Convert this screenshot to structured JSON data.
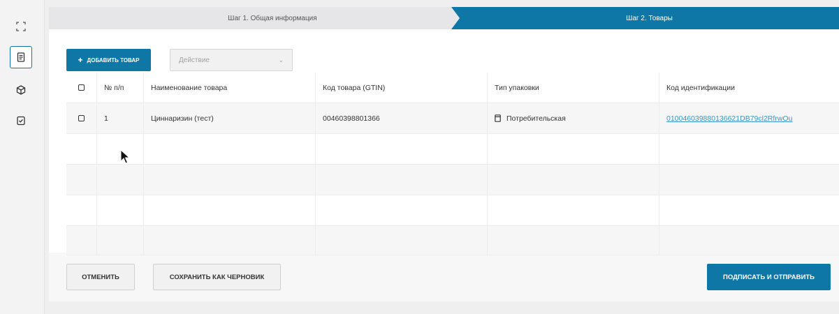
{
  "sidebar": {
    "items": [
      {
        "icon": "expand-icon",
        "active": false
      },
      {
        "icon": "document-icon",
        "active": true
      },
      {
        "icon": "box-icon",
        "active": false
      },
      {
        "icon": "checklist-icon",
        "active": false
      }
    ]
  },
  "stepper": {
    "step1": "Шаг 1. Общая информация",
    "step2": "Шаг 2. Товары"
  },
  "toolbar": {
    "add_label": "ДОБАВИТЬ ТОВАР",
    "add_icon": "+",
    "action_placeholder": "Действие"
  },
  "table": {
    "headers": [
      "№ п/п",
      "Наименование товара",
      "Код товара (GTIN)",
      "Тип упаковки",
      "Код идентификации"
    ],
    "rows": [
      {
        "num": "1",
        "name": "Циннаризин (тест)",
        "gtin": "00460398801366",
        "package": "Потребительская",
        "code": "010046039880136621DB79cl2RfrwOu"
      }
    ]
  },
  "footer": {
    "cancel_label": "ОТМЕНИТЬ",
    "draft_label": "СОХРАНИТЬ КАК ЧЕРНОВИК",
    "sign_label": "ПОДПИСАТЬ И ОТПРАВИТЬ"
  },
  "colors": {
    "primary": "#0e77a6",
    "link": "#3a95c9"
  }
}
